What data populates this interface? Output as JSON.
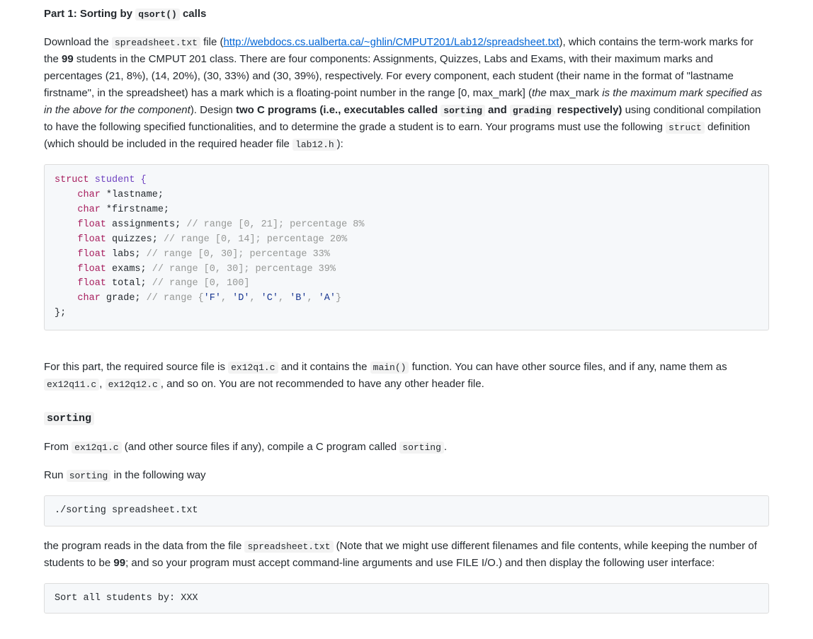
{
  "heading": {
    "prefix": "Part 1: Sorting by ",
    "code": "qsort()",
    "suffix": " calls"
  },
  "intro": {
    "t1": "Download the ",
    "c1": "spreadsheet.txt",
    "t2": " file (",
    "link": "http://webdocs.cs.ualberta.ca/~ghlin/CMPUT201/Lab12/spreadsheet.txt",
    "t3": "), which contains the term-work marks for the ",
    "num99a": "99",
    "t4": " students in the CMPUT 201 class. There are four components: Assignments, Quizzes, Labs and Exams, with their maximum marks and percentages (21, 8%), (14, 20%), (30, 33%) and (30, 39%), respectively. For every component, each student (their name in the format of \"lastname firstname\", in the spreadsheet) has a mark which is a floating-point number in the range ",
    "range_open": "[0",
    "t5": ", max_mark] (",
    "italic1": "the",
    "t6": " max_mark ",
    "italic2": "is the maximum mark specified as in the above for the component",
    "t7": "). Design ",
    "bold1": "two C programs (i.e., executables called ",
    "c_sort": "sorting",
    "bold2": " and ",
    "c_grade": "grading",
    "bold3": " respectively)",
    "t8": " using conditional compilation to have the following specified functionalities, and to determine the grade a student is to earn. Your programs must use the following ",
    "c_struct": "struct",
    "t9": " definition (which should be included in the required header file ",
    "c_lab": "lab12.h",
    "t10": "):"
  },
  "struct_code": {
    "l0_kw1": "struct",
    "l0_name": " student {",
    "l1_ind": "    ",
    "l1_kw": "char",
    "l1_rest": " *lastname;",
    "l2_kw": "char",
    "l2_rest": " *firstname;",
    "l3_kw": "float",
    "l3_name": " assignments; ",
    "l3_cmt": "// range [0, 21]; percentage 8%",
    "l4_kw": "float",
    "l4_name": " quizzes; ",
    "l4_cmt": "// range [0, 14]; percentage 20%",
    "l5_kw": "float",
    "l5_name": " labs; ",
    "l5_cmt": "// range [0, 30]; percentage 33%",
    "l6_kw": "float",
    "l6_name": " exams; ",
    "l6_cmt": "// range [0, 30]; percentage 39%",
    "l7_kw": "float",
    "l7_name": " total; ",
    "l7_cmt": "// range [0, 100]",
    "l8_kw": "char",
    "l8_name": " grade; ",
    "l8_cmt_a": "// range {",
    "l8_s1": "'F'",
    "l8_sep": ", ",
    "l8_s2": "'D'",
    "l8_s3": "'C'",
    "l8_s4": "'B'",
    "l8_s5": "'A'",
    "l8_cmt_b": "}",
    "l9": "};"
  },
  "after_struct": {
    "t1": "For this part, the required source file is ",
    "c1": "ex12q1.c",
    "t2": " and it contains the ",
    "c2": "main()",
    "t3": " function. You can have other source files, and if any, name them as ",
    "c3": "ex12q11.c",
    "t4": ", ",
    "c4": "ex12q12.c",
    "t5": ", and so on. You are not recommended to have any other header file."
  },
  "sort_section_title": "sorting",
  "sort_para1": {
    "t1": "From ",
    "c1": "ex12q1.c",
    "t2": " (and other source files if any), compile a C program called ",
    "c2": "sorting",
    "t3": "."
  },
  "sort_para2": {
    "t1": "Run ",
    "c1": "sorting",
    "t2": " in the following way"
  },
  "run_cmd": "./sorting spreadsheet.txt",
  "sort_para3": {
    "t1": "the program reads in the data from the file ",
    "c1": "spreadsheet.txt",
    "t2": " (Note that we might use different filenames and file contents, while keeping the number of students to be ",
    "num99b": "99",
    "t3": "; and so your program must accept command-line arguments and use FILE I/O.) and then display the following user interface:"
  },
  "ui_output": "Sort all students by: XXX"
}
